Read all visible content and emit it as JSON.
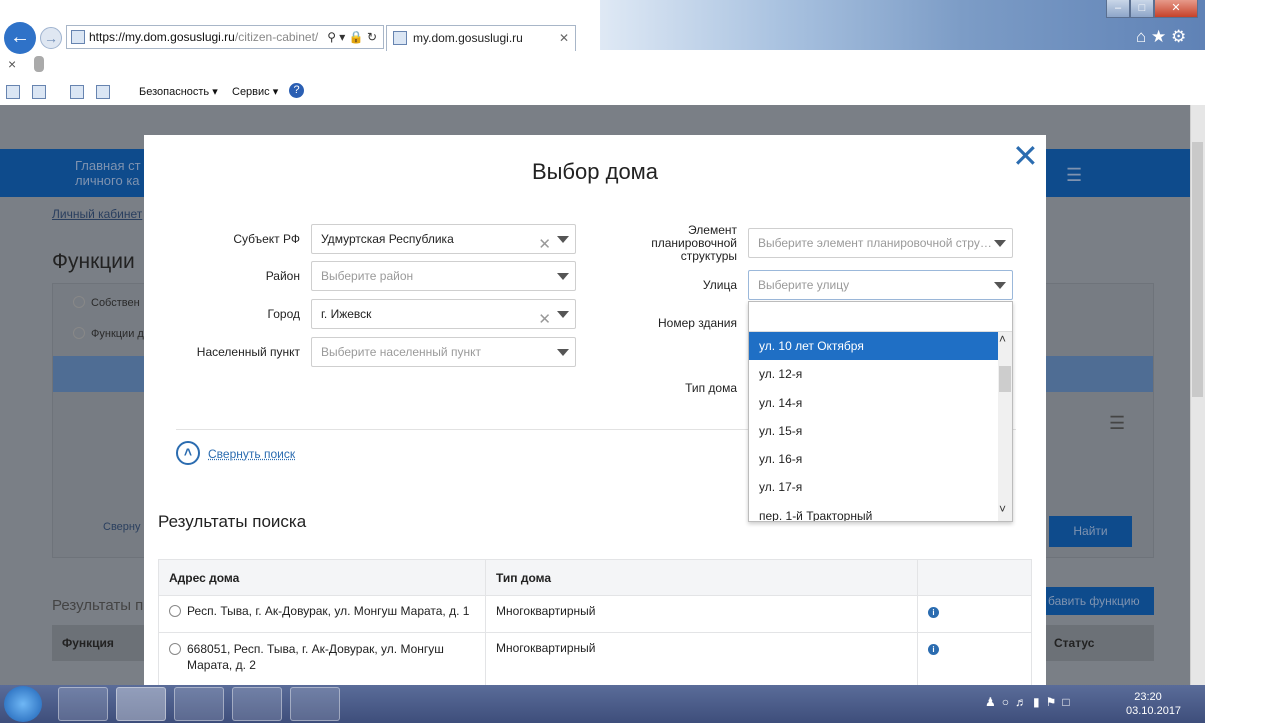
{
  "browser": {
    "url_prefix": "https://my.dom.",
    "url_domain": "gosuslugi.ru",
    "url_path": "/citizen-cabinet/",
    "tab_title": "my.dom.gosuslugi.ru",
    "toolbar_security": "Безопасность ▾",
    "toolbar_service": "Сервис ▾",
    "window_min": "–",
    "window_max": "□",
    "window_close": "✕"
  },
  "page_bg": {
    "nav_main": "Главная ст",
    "nav_cabinet": "личного ка",
    "breadcrumb": "Личный кабинет",
    "heading": "Функции",
    "radio_owner": "Собствен",
    "radio_functions": "Функции д",
    "collapse_link": "Сверну",
    "results_label": "Результаты п",
    "col_function": "Функция",
    "col_status": "Статус",
    "find_button": "Найти",
    "add_function_button": "бавить функцию"
  },
  "modal": {
    "title": "Выбор дома",
    "close": "✕",
    "left_fields": [
      {
        "label": "Субъект РФ",
        "value": "Удмуртская Республика",
        "placeholder": "",
        "clearable": true
      },
      {
        "label": "Район",
        "value": "",
        "placeholder": "Выберите район",
        "clearable": false
      },
      {
        "label": "Город",
        "value": "г. Ижевск",
        "placeholder": "",
        "clearable": true
      },
      {
        "label": "Населенный пункт",
        "value": "",
        "placeholder": "Выберите населенный пункт",
        "clearable": false
      }
    ],
    "planning_label_1": "Элемент",
    "planning_label_2": "планировочной",
    "planning_label_3": "структуры",
    "planning_placeholder": "Выберите элемент планировочной стру…",
    "street_label": "Улица",
    "street_placeholder": "Выберите улицу",
    "building_label": "Номер здания",
    "house_type_label": "Тип дома",
    "collapse_search": "Свернуть поиск",
    "results_title": "Результаты поиска",
    "table": {
      "headers": [
        "Адрес дома",
        "Тип дома",
        ""
      ],
      "rows": [
        {
          "address": "Респ. Тыва, г. Ак-Довурак, ул. Монгуш Марата, д. 1",
          "type": "Многоквартирный"
        },
        {
          "address": "668051, Респ. Тыва, г. Ак-Довурак, ул. Монгуш Марата, д. 2",
          "type": "Многоквартирный"
        }
      ]
    },
    "street_dropdown": {
      "options": [
        "ул. 10 лет Октября",
        "ул. 12-я",
        "ул. 14-я",
        "ул. 15-я",
        "ул. 16-я",
        "ул. 17-я",
        "пер. 1-й Тракторный"
      ],
      "selected_index": 0
    }
  },
  "taskbar": {
    "time": "23:20",
    "date": "03.10.2017"
  },
  "colors": {
    "accent": "#1f6fc5",
    "link": "#2b6cb0",
    "header_band": "#0e4b8c"
  }
}
